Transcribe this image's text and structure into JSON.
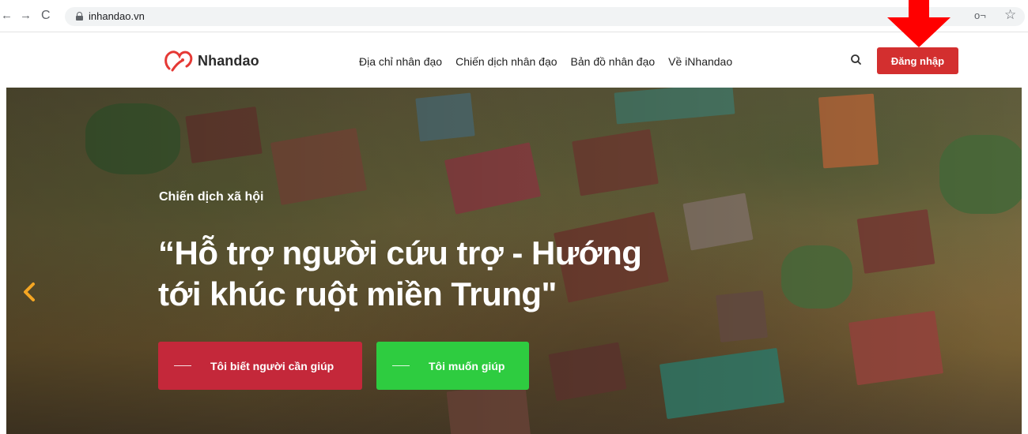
{
  "browser": {
    "url": "inhandao.vn",
    "back_icon": "←",
    "forward_icon": "→",
    "reload_icon": "C",
    "key_icon": "o¬",
    "star_icon": "☆"
  },
  "header": {
    "logo_text": "Nhandao",
    "nav": [
      {
        "label": "Địa chỉ nhân đạo"
      },
      {
        "label": "Chiến dịch nhân đạo"
      },
      {
        "label": "Bản đồ nhân đạo"
      },
      {
        "label": "Về iNhandao"
      }
    ],
    "login_label": "Đăng nhập",
    "colors": {
      "login_bg": "#d32f2f",
      "logo_accent": "#e53935"
    }
  },
  "hero": {
    "subtitle": "Chiến dịch xã hội",
    "title": "“Hỗ trợ người cứu trợ - Hướng tới khúc ruột miền Trung\"",
    "cta_need": "Tôi biết người cần giúp",
    "cta_help": "Tôi muốn giúp",
    "colors": {
      "cta_need": "#c4283a",
      "cta_help": "#2ecc40",
      "prev_arrow": "#f5a623"
    }
  },
  "annotation": {
    "arrow_color": "#ff0000"
  }
}
